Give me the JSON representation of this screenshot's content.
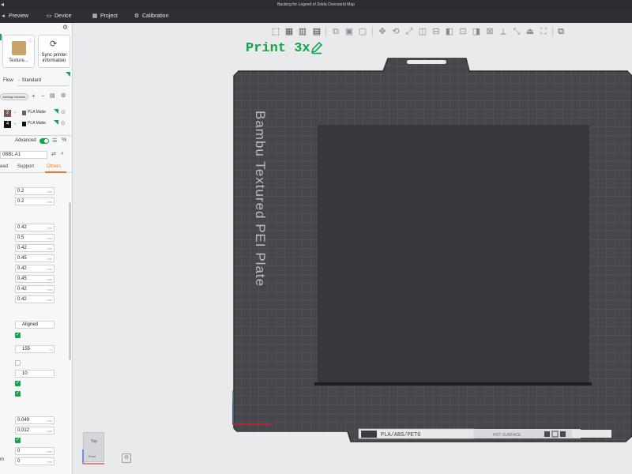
{
  "window": {
    "title": "Backing for Legend of Zelda Overworld Map"
  },
  "nav": {
    "tabs": [
      {
        "label": "Preview",
        "icon": "preview-icon"
      },
      {
        "label": "Device",
        "icon": "monitor-icon"
      },
      {
        "label": "Project",
        "icon": "project-icon"
      },
      {
        "label": "Calibration",
        "icon": "calibration-icon"
      }
    ]
  },
  "printer": {
    "plate_label": "Texture...",
    "sync_label_1": "Sync printer",
    "sync_label_2": "information",
    "flow_label": "Flow",
    "flow_value": "Standard",
    "flushing_label": "lushing volumes"
  },
  "filaments": [
    {
      "slot": "2",
      "color": "#7a5a52",
      "name": "PLA Matte"
    },
    {
      "slot": "4",
      "color": "#111111",
      "name": "PLA Matte"
    }
  ],
  "process": {
    "advanced_label": "Advanced",
    "profile": "0BBL A1",
    "tabs": [
      "eed",
      "Support",
      "Others"
    ],
    "active_tab": "Others",
    "accent": "#f97316"
  },
  "settings": {
    "layer_height": [
      {
        "value": "0.2",
        "unit": "mm"
      },
      {
        "value": "0.2",
        "unit": "mm"
      }
    ],
    "line_widths": [
      {
        "value": "0.42",
        "unit": "mm"
      },
      {
        "value": "0.5",
        "unit": "mm"
      },
      {
        "value": "0.42",
        "unit": "mm"
      },
      {
        "value": "0.45",
        "unit": "mm"
      },
      {
        "value": "0.42",
        "unit": "mm"
      },
      {
        "value": "0.45",
        "unit": "mm"
      },
      {
        "value": "0.42",
        "unit": "mm"
      },
      {
        "value": "0.42",
        "unit": "mm"
      }
    ],
    "seam": "Aligned",
    "angle": "155",
    "count": "10",
    "precision": [
      {
        "value": "0.049",
        "unit": "mm"
      },
      {
        "value": "0.012",
        "unit": "mm"
      }
    ],
    "zeros": [
      {
        "value": "0",
        "unit": "mm"
      },
      {
        "value": "0",
        "unit": "mm"
      }
    ],
    "last_label": "m"
  },
  "viewport": {
    "plate_title": "Print 3x",
    "bed_brand": "Bambu Textured PEI Plate",
    "bed_plate_text": "PLA/ABS/PETG",
    "hot_surface": "HOT SURFACE",
    "cube_label": "Top",
    "cube_sub": "Front",
    "accent": "#16a34a"
  }
}
